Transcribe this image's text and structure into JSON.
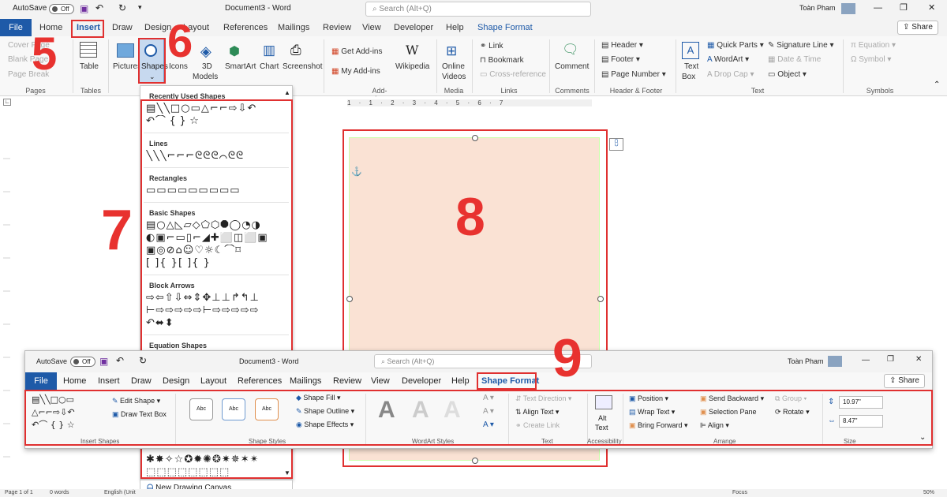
{
  "titlebar": {
    "autosave": "AutoSave",
    "toggle": "Off",
    "doc": "Document3 - Word",
    "search": "Search (Alt+Q)",
    "user": "Toàn Pham"
  },
  "tabs": [
    "File",
    "Home",
    "Insert",
    "Draw",
    "Design",
    "Layout",
    "References",
    "Mailings",
    "Review",
    "View",
    "Developer",
    "Help",
    "Shape Format"
  ],
  "share": "Share",
  "ribbon": {
    "pages": [
      "Cover Page",
      "Blank Page",
      "Page Break"
    ],
    "pages_label": "Pages",
    "table": "Table",
    "tables_label": "Tables",
    "pictures": "Pictures",
    "shapes": "Shapes",
    "icons": "Icons",
    "models": [
      "3D",
      "Models"
    ],
    "smartart": "SmartArt",
    "chart": "Chart",
    "screenshot": "Screenshot",
    "getaddins": "Get Add-ins",
    "myaddins": "My Add-ins",
    "wikipedia": "Wikipedia",
    "addins_label": "Add-ins",
    "online": [
      "Online",
      "Videos"
    ],
    "media_label": "Media",
    "link": "Link",
    "bookmark": "Bookmark",
    "crossref": "Cross-reference",
    "links_label": "Links",
    "comment": "Comment",
    "comments_label": "Comments",
    "header": "Header",
    "footer": "Footer",
    "pagenumber": "Page Number",
    "hf_label": "Header & Footer",
    "textbox": [
      "Text",
      "Box"
    ],
    "quickparts": "Quick Parts",
    "wordart": "WordArt",
    "dropcap": "Drop Cap",
    "sigline": "Signature Line",
    "datetime": "Date & Time",
    "object": "Object",
    "text_label": "Text",
    "equation": "Equation",
    "symbol": "Symbol",
    "symbols_label": "Symbols"
  },
  "ruler_numbers": "1 · 1 · 2 · 3 · 4 · 5 · 6 · 7",
  "shapes_panel": {
    "sections": [
      "Recently Used Shapes",
      "Lines",
      "Rectangles",
      "Basic Shapes",
      "Block Arrows",
      "Equation Shapes"
    ],
    "recent": [
      "▤╲╲□○▭△⌐⌐⇨⇩↶",
      "↶⌒ { } ☆"
    ],
    "lines": [
      "╲╲╲⌐⌐⌐ᘓᘓᘓ⌒ᘓᘓ"
    ],
    "rects": [
      "▭▭▭▭▭▭▭▭▭"
    ],
    "basic": [
      "▤○△◺▱◇⬠⬡⯃◯◔◑",
      "◐▣⌐▭▯⌐◢✚⬜◫⬜▣",
      "▣◎⊘⌂☺♡☼☾⌒⌑",
      "[ ]{ }[ ]{ }"
    ],
    "arrows": [
      "⇨⇦⇧⇩⇔⇕✥⊥⊥↱↰⊥",
      "⊢⇨⇨⇨⇨⇨⊢⇨⇨⇨⇨⇨",
      "↶⬌⬍"
    ],
    "stars": [
      "✱✸✧☆✪✹✺❂✷✵✶✴",
      "⬚⬚⬚⬚⬚⬚⬚⬚"
    ],
    "new_canvas": "New Drawing Canvas"
  },
  "annotations": [
    "5",
    "6",
    "7",
    "8",
    "9"
  ],
  "overlay": {
    "autosave": "AutoSave",
    "toggle": "Off",
    "doc": "Document3 - Word",
    "search": "Search (Alt+Q)",
    "user": "Toàn Pham",
    "tabs": [
      "File",
      "Home",
      "Insert",
      "Draw",
      "Design",
      "Layout",
      "References",
      "Mailings",
      "Review",
      "View",
      "Developer",
      "Help",
      "Shape Format"
    ],
    "share": "Share",
    "edit_shape": "Edit Shape",
    "draw_textbox": "Draw Text Box",
    "insert_shapes_label": "Insert Shapes",
    "abc": "Abc",
    "shape_styles_label": "Shape Styles",
    "shape_fill": "Shape Fill",
    "shape_outline": "Shape Outline",
    "shape_effects": "Shape Effects",
    "wordart_label": "WordArt Styles",
    "wa_letter": "A",
    "text_direction": "Text Direction",
    "align_text": "Align Text",
    "create_link": "Create Link",
    "text_label": "Text",
    "alt_text": [
      "Alt",
      "Text"
    ],
    "accessibility_label": "Accessibility",
    "position": "Position",
    "wrap_text": "Wrap Text",
    "bring_forward": "Bring Forward",
    "send_backward": "Send Backward",
    "selection_pane": "Selection Pane",
    "align": "Align",
    "group": "Group",
    "rotate": "Rotate",
    "arrange_label": "Arrange",
    "height": "10.97\"",
    "width": "8.47\"",
    "size_label": "Size"
  },
  "status": {
    "page": "Page 1 of 1",
    "words": "0 words",
    "lang": "English (Unit",
    "focus": "Focus",
    "zoom": "50%"
  },
  "colors": {
    "accent": "#1e5aa8",
    "highlight": "#e03030",
    "canvas": "#fae2d4"
  }
}
